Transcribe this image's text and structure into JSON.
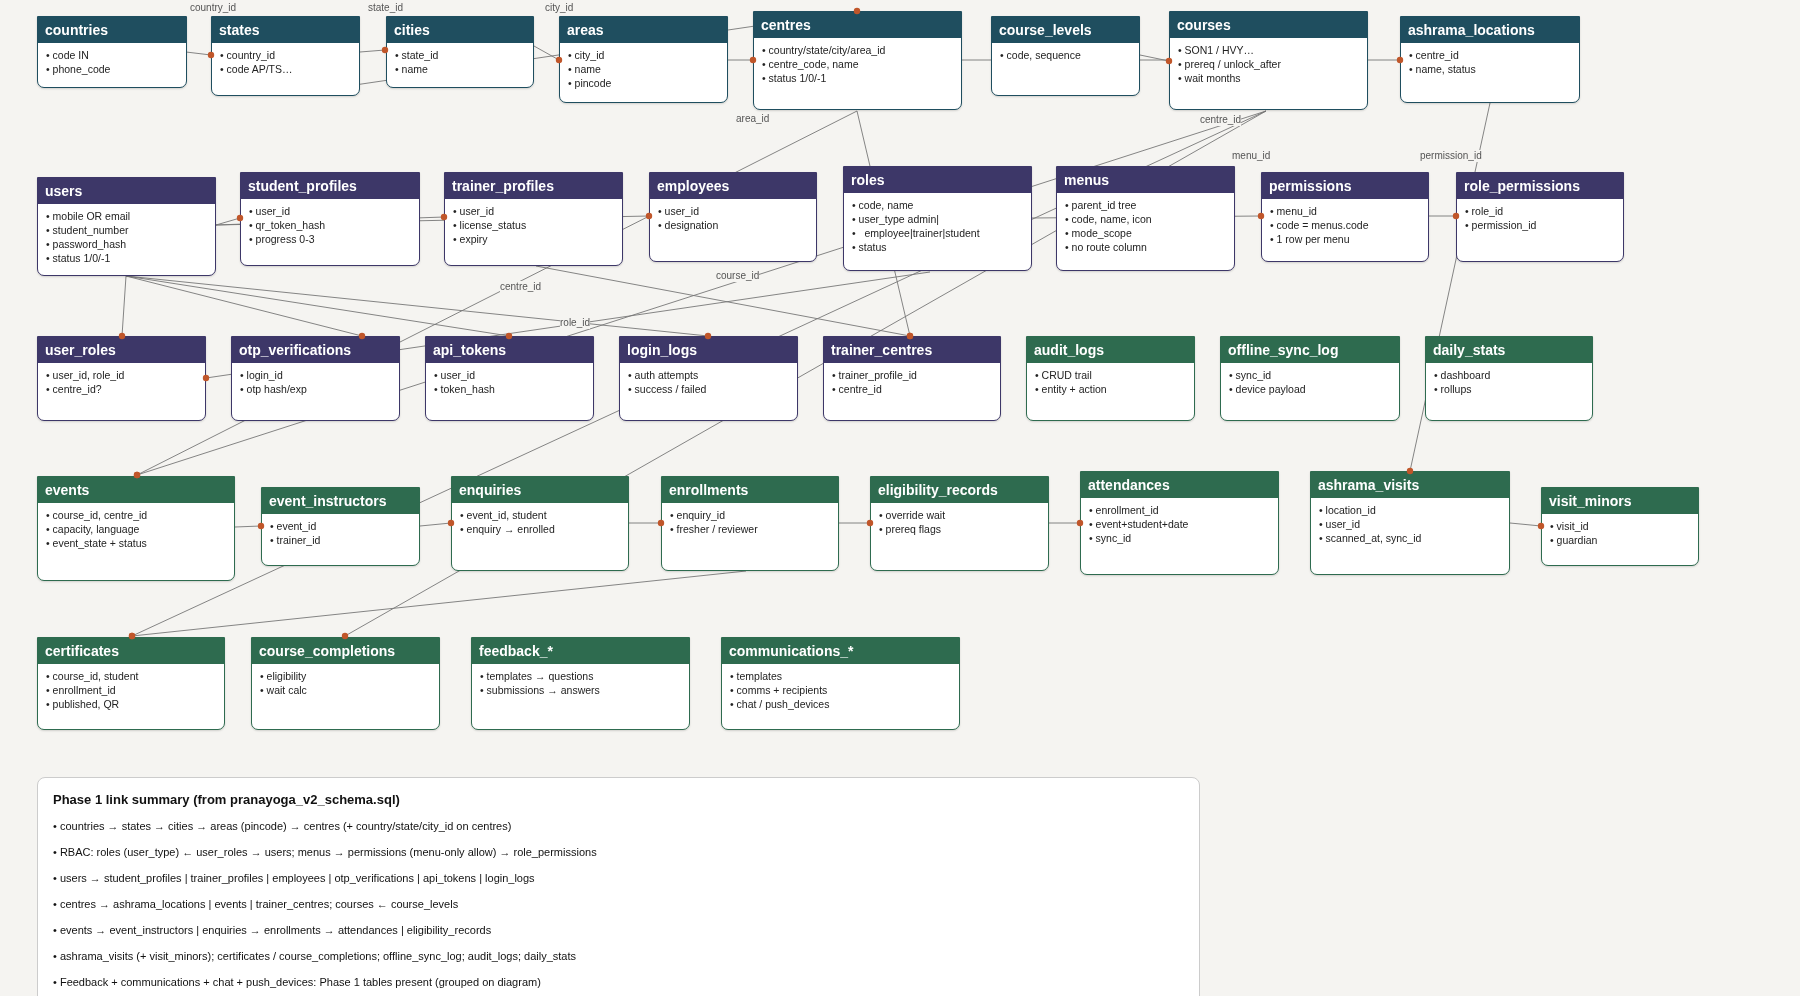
{
  "tables": [
    {
      "name": "countries",
      "kind": "location",
      "fields": [
        "• code IN",
        "• phone_code"
      ]
    },
    {
      "name": "states",
      "kind": "location",
      "fields": [
        "• country_id",
        "• code AP/TS…"
      ]
    },
    {
      "name": "cities",
      "kind": "location",
      "fields": [
        "• state_id",
        "• name"
      ]
    },
    {
      "name": "areas",
      "kind": "location",
      "fields": [
        "• city_id",
        "• name",
        "• pincode"
      ]
    },
    {
      "name": "centres",
      "kind": "location",
      "fields": [
        "• country/state/city/area_id",
        "• centre_code, name",
        "• status 1/0/-1"
      ]
    },
    {
      "name": "course_levels",
      "kind": "location",
      "fields": [
        "• code, sequence"
      ]
    },
    {
      "name": "courses",
      "kind": "location",
      "fields": [
        "• SON1 / HVY…",
        "• prereq / unlock_after",
        "• wait months"
      ]
    },
    {
      "name": "ashrama_locations",
      "kind": "location",
      "fields": [
        "• centre_id",
        "• name, status"
      ]
    },
    {
      "name": "users",
      "kind": "identity",
      "fields": [
        "• mobile OR email",
        "• student_number",
        "• password_hash",
        "• status 1/0/-1"
      ]
    },
    {
      "name": "student_profiles",
      "kind": "identity",
      "fields": [
        "• user_id",
        "• qr_token_hash",
        "• progress 0-3"
      ]
    },
    {
      "name": "trainer_profiles",
      "kind": "identity",
      "fields": [
        "• user_id",
        "• license_status",
        "• expiry"
      ]
    },
    {
      "name": "employees",
      "kind": "identity",
      "fields": [
        "• user_id",
        "• designation"
      ]
    },
    {
      "name": "roles",
      "kind": "identity",
      "fields": [
        "• code, name",
        "• user_type admin|",
        "•   employee|trainer|student",
        "• status"
      ]
    },
    {
      "name": "menus",
      "kind": "identity",
      "fields": [
        "• parent_id tree",
        "• code, name, icon",
        "• mode_scope",
        "• no route column"
      ]
    },
    {
      "name": "permissions",
      "kind": "identity",
      "fields": [
        "• menu_id",
        "• code = menus.code",
        "• 1 row per menu"
      ]
    },
    {
      "name": "role_permissions",
      "kind": "identity",
      "fields": [
        "• role_id",
        "• permission_id"
      ]
    },
    {
      "name": "user_roles",
      "kind": "identity",
      "fields": [
        "• user_id, role_id",
        "• centre_id?"
      ]
    },
    {
      "name": "otp_verifications",
      "kind": "identity",
      "fields": [
        "• login_id",
        "• otp hash/exp"
      ]
    },
    {
      "name": "api_tokens",
      "kind": "identity",
      "fields": [
        "• user_id",
        "• token_hash"
      ]
    },
    {
      "name": "login_logs",
      "kind": "identity",
      "fields": [
        "• auth attempts",
        "• success / failed"
      ]
    },
    {
      "name": "trainer_centres",
      "kind": "identity",
      "fields": [
        "• trainer_profile_id",
        "• centre_id"
      ]
    },
    {
      "name": "audit_logs",
      "kind": "operations",
      "fields": [
        "• CRUD trail",
        "• entity + action"
      ]
    },
    {
      "name": "offline_sync_log",
      "kind": "operations",
      "fields": [
        "• sync_id",
        "• device payload"
      ]
    },
    {
      "name": "daily_stats",
      "kind": "operations",
      "fields": [
        "• dashboard",
        "• rollups"
      ]
    },
    {
      "name": "events",
      "kind": "operations",
      "fields": [
        "• course_id, centre_id",
        "• capacity, language",
        "• event_state + status"
      ]
    },
    {
      "name": "event_instructors",
      "kind": "operations",
      "fields": [
        "• event_id",
        "• trainer_id"
      ]
    },
    {
      "name": "enquiries",
      "kind": "operations",
      "fields": [
        "• event_id, student",
        "• enquiry → enrolled"
      ]
    },
    {
      "name": "enrollments",
      "kind": "operations",
      "fields": [
        "• enquiry_id",
        "• fresher / reviewer"
      ]
    },
    {
      "name": "eligibility_records",
      "kind": "operations",
      "fields": [
        "• override wait",
        "• prereq flags"
      ]
    },
    {
      "name": "attendances",
      "kind": "operations",
      "fields": [
        "• enrollment_id",
        "• event+student+date",
        "• sync_id"
      ]
    },
    {
      "name": "ashrama_visits",
      "kind": "operations",
      "fields": [
        "• location_id",
        "• user_id",
        "• scanned_at, sync_id"
      ]
    },
    {
      "name": "visit_minors",
      "kind": "operations",
      "fields": [
        "• visit_id",
        "• guardian"
      ]
    },
    {
      "name": "certificates",
      "kind": "operations",
      "fields": [
        "• course_id, student",
        "• enrollment_id",
        "• published, QR"
      ]
    },
    {
      "name": "course_completions",
      "kind": "operations",
      "fields": [
        "• eligibility",
        "• wait calc"
      ]
    },
    {
      "name": "feedback_*",
      "kind": "operations",
      "fields": [
        "• templates → questions",
        "• submissions → answers"
      ]
    },
    {
      "name": "communications_*",
      "kind": "operations",
      "fields": [
        "• templates",
        "• comms + recipients",
        "• chat / push_devices"
      ]
    }
  ],
  "edge_labels": [
    "country_id",
    "state_id",
    "city_id",
    "area_id",
    "centre_id",
    "menu_id",
    "role_id",
    "centre_id",
    "course_id",
    "permission_id"
  ],
  "summary": {
    "title": "Phase 1 link summary (from pranayoga_v2_schema.sql)",
    "lines": [
      "• countries → states → cities → areas (pincode) → centres (+ country/state/city_id on centres)",
      "• RBAC: roles (user_type) ← user_roles → users; menus → permissions (menu-only allow) → role_permissions",
      "• users → student_profiles | trainer_profiles | employees | otp_verifications | api_tokens | login_logs",
      "• centres → ashrama_locations | events | trainer_centres; courses ← course_levels",
      "• events → event_instructors | enquiries → enrollments → attendances | eligibility_records",
      "• ashrama_visits (+ visit_minors); certificates / course_completions; offline_sync_log; audit_logs; daily_stats",
      "• Feedback + communications + chat + push_devices: Phase 1 tables present (grouped on diagram)"
    ]
  }
}
